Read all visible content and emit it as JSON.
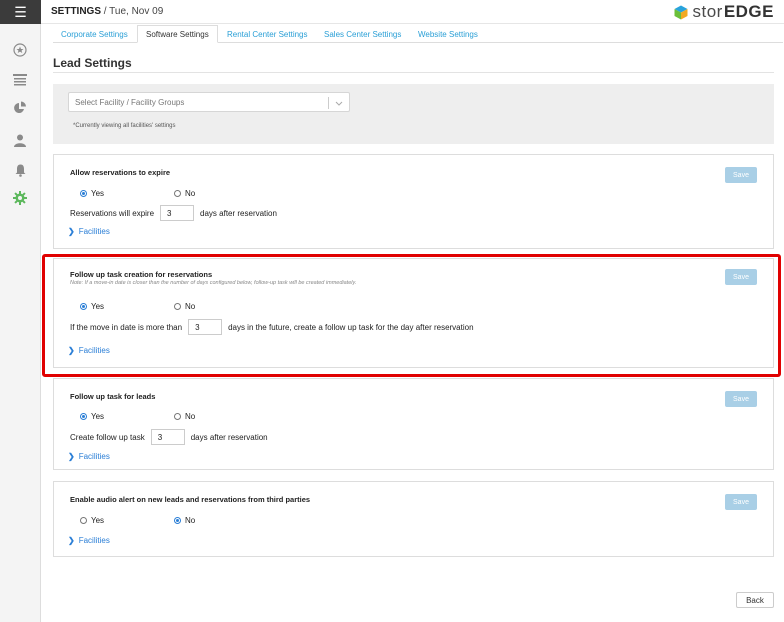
{
  "header": {
    "section": "SETTINGS",
    "separator": " / ",
    "date": "Tue, Nov 09",
    "logo_a": "stor",
    "logo_b": "EDGE"
  },
  "tabs": [
    {
      "label": "Corporate Settings",
      "active": false
    },
    {
      "label": "Software Settings",
      "active": true
    },
    {
      "label": "Rental Center Settings",
      "active": false
    },
    {
      "label": "Sales Center Settings",
      "active": false
    },
    {
      "label": "Website Settings",
      "active": false
    }
  ],
  "page": {
    "title": "Lead Settings"
  },
  "facility_filter": {
    "placeholder": "Select Facility / Facility Groups",
    "note": "*Currently viewing all facilities' settings"
  },
  "cards": {
    "expire": {
      "title": "Allow reservations to expire",
      "save": "Save",
      "yes": "Yes",
      "no": "No",
      "selected": "Yes",
      "prefix": "Reservations will expire",
      "value": "3",
      "suffix": "days after reservation",
      "facilities": "Facilities"
    },
    "followup_res": {
      "title": "Follow up task creation for reservations",
      "note": "Note: If a move-in date is closer than the number of days configured below, follow-up task will be created immediately.",
      "save": "Save",
      "yes": "Yes",
      "no": "No",
      "selected": "Yes",
      "prefix": "If the move in date is more than",
      "value": "3",
      "suffix": "days in the future, create a follow up task for the day after reservation",
      "facilities": "Facilities"
    },
    "followup_leads": {
      "title": "Follow up task for leads",
      "save": "Save",
      "yes": "Yes",
      "no": "No",
      "selected": "Yes",
      "prefix": "Create follow up task",
      "value": "3",
      "suffix": "days after reservation",
      "facilities": "Facilities"
    },
    "audio": {
      "title": "Enable audio alert on new leads and reservations from third parties",
      "save": "Save",
      "yes": "Yes",
      "no": "No",
      "selected": "No",
      "facilities": "Facilities"
    }
  },
  "footer": {
    "back": "Back"
  },
  "colors": {
    "accent": "#2a7ed6",
    "save_disabled": "#a9cfe6",
    "highlight": "#e00000",
    "sidebar_active": "#5cb85c"
  },
  "sidebar": {
    "icons": [
      "menu-icon",
      "star-icon",
      "list-icon",
      "pie-chart-icon",
      "user-icon",
      "bell-icon",
      "gear-icon"
    ]
  }
}
